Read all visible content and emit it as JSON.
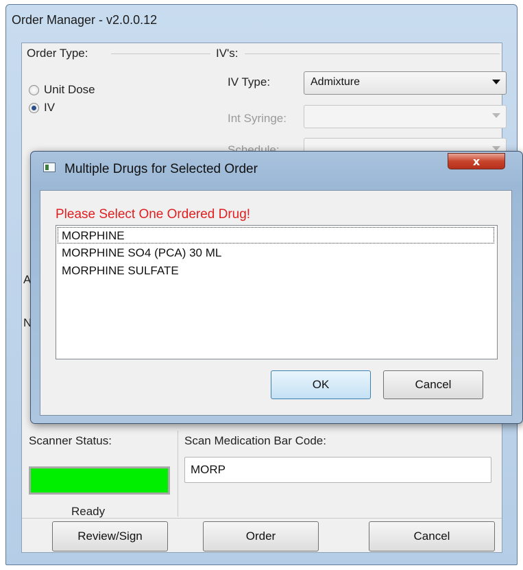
{
  "window": {
    "title": "Order Manager - v2.0.0.12"
  },
  "order_type": {
    "label": "Order Type:",
    "options": [
      {
        "label": "Unit Dose",
        "checked": false
      },
      {
        "label": "IV",
        "checked": true
      }
    ]
  },
  "ivs": {
    "label": "IV's:",
    "iv_type_label": "IV Type:",
    "iv_type_value": "Admixture",
    "int_syringe_label": "Int Syringe:",
    "int_syringe_value": "",
    "schedule_label": "Schedule:"
  },
  "partial_labels": {
    "a": "A",
    "n": "N"
  },
  "scanner": {
    "status_label": "Scanner Status:",
    "status_color": "#00ee00",
    "status_text": "Ready"
  },
  "scan": {
    "label": "Scan Medication Bar Code:",
    "value": "MORP"
  },
  "buttons": {
    "review_sign": "Review/Sign",
    "order": "Order",
    "cancel": "Cancel"
  },
  "dialog": {
    "title": "Multiple Drugs for Selected Order",
    "close_glyph": "x",
    "prompt": "Please Select One Ordered Drug!",
    "prompt_color": "#e02020",
    "items": [
      "MORPHINE",
      "MORPHINE SO4 (PCA) 30 ML",
      "MORPHINE SULFATE"
    ],
    "ok_label": "OK",
    "cancel_label": "Cancel"
  }
}
